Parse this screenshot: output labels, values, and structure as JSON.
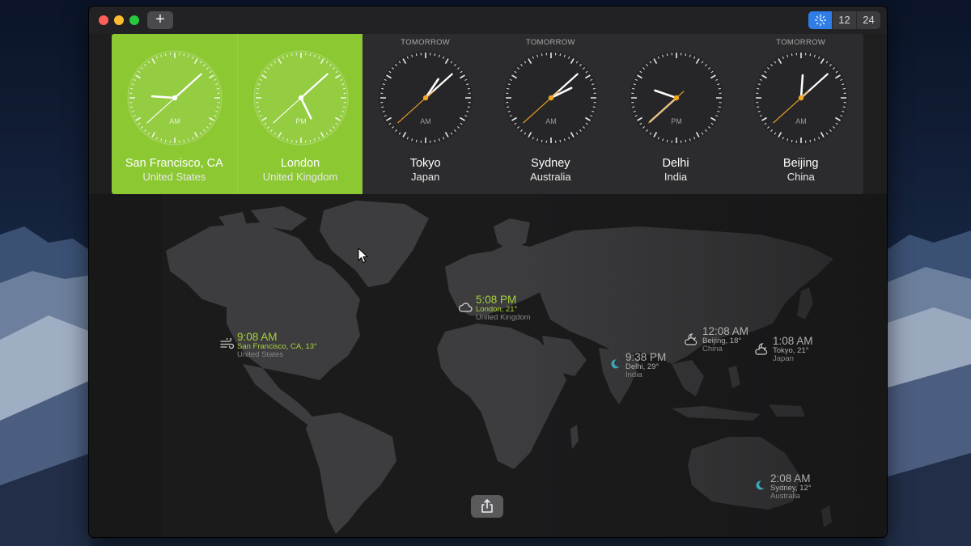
{
  "toolbar": {
    "add_label": "+",
    "view_modes": [
      "analog-icon",
      "12",
      "24"
    ],
    "active_mode": "analog"
  },
  "clocks": [
    {
      "tag": "",
      "city": "San Francisco, CA",
      "country": "United States",
      "ampm": "AM",
      "hour": 9,
      "minute": 8,
      "second": 38,
      "home": true
    },
    {
      "tag": "",
      "city": "London",
      "country": "United Kingdom",
      "ampm": "PM",
      "hour": 5,
      "minute": 8,
      "second": 38,
      "home": true
    },
    {
      "tag": "TOMORROW",
      "city": "Tokyo",
      "country": "Japan",
      "ampm": "AM",
      "hour": 1,
      "minute": 8,
      "second": 38,
      "home": false
    },
    {
      "tag": "TOMORROW",
      "city": "Sydney",
      "country": "Australia",
      "ampm": "AM",
      "hour": 2,
      "minute": 8,
      "second": 38,
      "home": false
    },
    {
      "tag": "",
      "city": "Delhi",
      "country": "India",
      "ampm": "PM",
      "hour": 9,
      "minute": 38,
      "second": 38,
      "home": false
    },
    {
      "tag": "TOMORROW",
      "city": "Beijing",
      "country": "China",
      "ampm": "AM",
      "hour": 12,
      "minute": 8,
      "second": 38,
      "home": false
    }
  ],
  "map_pins": [
    {
      "id": "sf",
      "time": "9:08 AM",
      "location": "San Francisco, CA, 13°",
      "country": "United States",
      "weather": "wind-icon",
      "daylight": true
    },
    {
      "id": "london",
      "time": "5:08 PM",
      "location": "London, 21°",
      "country": "United Kingdom",
      "weather": "cloud-icon",
      "daylight": true
    },
    {
      "id": "delhi",
      "time": "9:38 PM",
      "location": "Delhi, 29°",
      "country": "India",
      "weather": "moon-icon",
      "daylight": false
    },
    {
      "id": "beijing",
      "time": "12:08 AM",
      "location": "Beijing, 18°",
      "country": "China",
      "weather": "moon-cloud-icon",
      "daylight": false
    },
    {
      "id": "tokyo",
      "time": "1:08 AM",
      "location": "Tokyo, 21°",
      "country": "Japan",
      "weather": "moon-cloud-icon",
      "daylight": false
    },
    {
      "id": "sydney",
      "time": "2:08 AM",
      "location": "Sydney, 12°",
      "country": "Australia",
      "weather": "moon-icon",
      "daylight": false
    }
  ],
  "colors": {
    "home_green": "#8bc832",
    "day_text": "#a6d13a",
    "night_text": "#b0b0b0",
    "second_hand": "#f5a623",
    "accent_blue": "#2f7ee8",
    "moon_teal": "#3aa6b6"
  },
  "share_icon": "share-icon"
}
